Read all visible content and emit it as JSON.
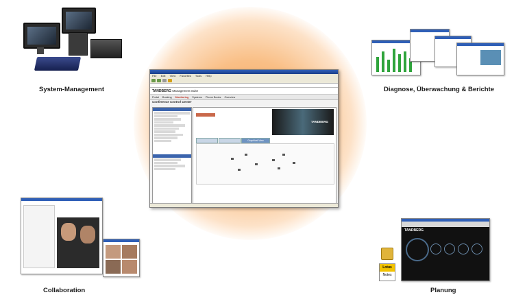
{
  "captions": {
    "system_management": "System-Management",
    "diagnose": "Diagnose, Überwachung & Berichte",
    "collaboration": "Collaboration",
    "planning": "Planung"
  },
  "main_window": {
    "app_name": "TANDBERG",
    "app_suffix": "Management Suite",
    "subtitle": "Conference Control Center",
    "banner_brand": "TANDBERG",
    "active_tab": "Graphical View",
    "nav": [
      "Portal",
      "Booking",
      "Monitoring",
      "Systems",
      "Phone Books",
      "Overview"
    ],
    "menu": [
      "File",
      "Edit",
      "View",
      "Favorites",
      "Tools",
      "Help"
    ]
  },
  "planning_screen": {
    "brand": "TANDBERG"
  },
  "lotus": {
    "top": "Lotus",
    "bottom": "Notes"
  },
  "colors": {
    "glow": "#f6a25a",
    "window_title": "#2f5fb7"
  }
}
